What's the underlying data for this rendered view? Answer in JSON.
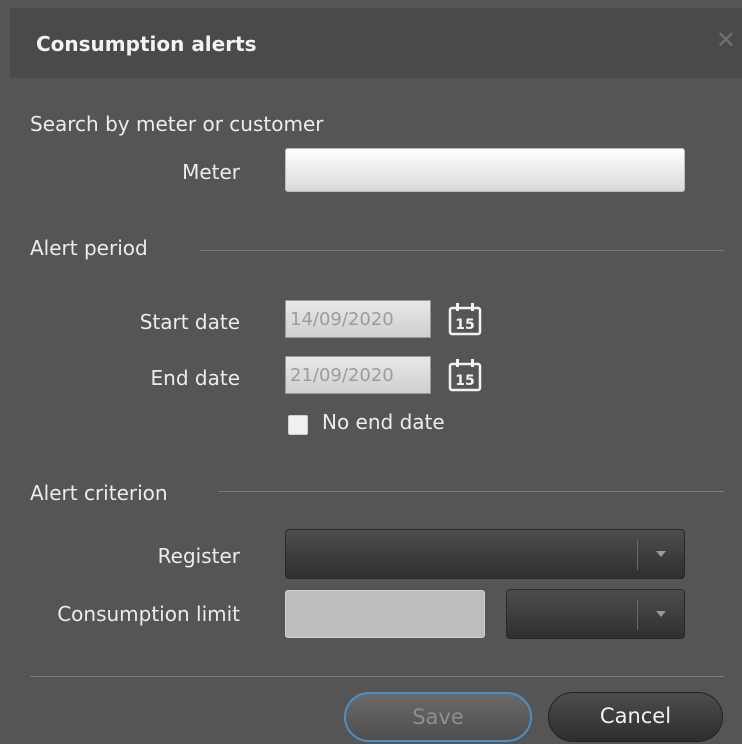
{
  "dialog": {
    "title": "Consumption alerts",
    "close_glyph": "✕"
  },
  "search": {
    "section_label": "Search by meter or customer",
    "meter_label": "Meter",
    "meter_value": ""
  },
  "period": {
    "section_label": "Alert period",
    "start_label": "Start date",
    "start_value": "14/09/2020",
    "end_label": "End date",
    "end_value": "21/09/2020",
    "calendar_day": "15",
    "no_end_label": "No end date",
    "no_end_checked": false
  },
  "criterion": {
    "section_label": "Alert criterion",
    "register_label": "Register",
    "register_value": "",
    "limit_label": "Consumption limit",
    "limit_value": "",
    "unit_value": ""
  },
  "actions": {
    "save_label": "Save",
    "cancel_label": "Cancel"
  },
  "colors": {
    "background": "#555555",
    "focus_ring": "#4a90c8"
  }
}
